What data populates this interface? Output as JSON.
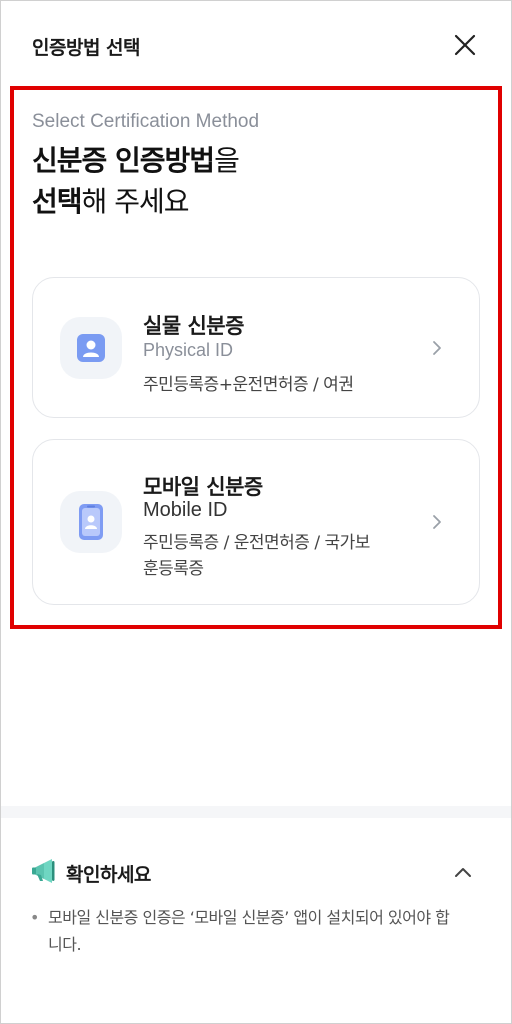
{
  "header": {
    "title": "인증방법 선택",
    "close_icon": "close-icon"
  },
  "intro": {
    "subtitle": "Select Certification Method",
    "heading_bold_1": "신분증 인증방법",
    "heading_reg_1": "을",
    "heading_bold_2": "선택",
    "heading_reg_2": "해 주세요"
  },
  "options": [
    {
      "title": "실물 신분증",
      "title_en": "Physical ID",
      "description": "주민등록증+운전면허증 / 여권",
      "icon": "id-card-icon"
    },
    {
      "title": "모바일 신분증",
      "title_en": "Mobile ID",
      "description": "주민등록증 / 운전면허증 / 국가보훈등록증",
      "icon": "mobile-id-icon"
    }
  ],
  "notice": {
    "title": "확인하세요",
    "icon": "megaphone-icon",
    "bullet": "•",
    "text": "모바일 신분증 인증은 ‘모바일 신분증’ 앱이 설치되어 있어야 합니다."
  },
  "colors": {
    "highlight": "#e00000",
    "icon_bg": "#f1f4f8",
    "icon_blue": "#6b8cf0",
    "subtitle_gray": "#8a8f99"
  }
}
